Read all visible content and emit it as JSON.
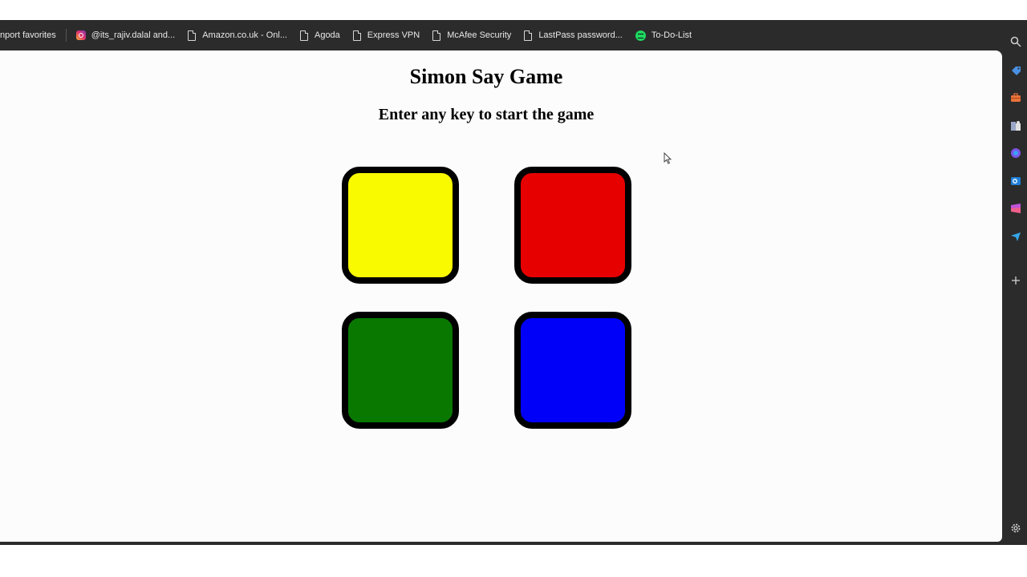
{
  "bookmarks": [
    {
      "label": "nport favorites",
      "icon": "none"
    },
    {
      "label": "@its_rajiv.dalal and...",
      "icon": "instagram-icon"
    },
    {
      "label": "Amazon.co.uk - Onl...",
      "icon": "document-icon"
    },
    {
      "label": "Agoda",
      "icon": "document-icon"
    },
    {
      "label": "Express VPN",
      "icon": "document-icon"
    },
    {
      "label": "McAfee Security",
      "icon": "document-icon"
    },
    {
      "label": "LastPass password...",
      "icon": "document-icon"
    },
    {
      "label": "To-Do-List",
      "icon": "spotify-icon"
    }
  ],
  "game": {
    "title": "Simon Say Game",
    "subtitle": "Enter any key to start the game",
    "pads": [
      {
        "name": "yellow",
        "color": "#f9f900"
      },
      {
        "name": "red",
        "color": "#e60000"
      },
      {
        "name": "green",
        "color": "#087800"
      },
      {
        "name": "blue",
        "color": "#0000f8"
      }
    ]
  },
  "sidebar_icons": [
    "search-icon",
    "shopping-tag-icon",
    "toolbox-icon",
    "chess-icon",
    "copilot-icon",
    "outlook-icon",
    "designer-icon",
    "send-icon",
    "add-icon",
    "settings-icon"
  ],
  "colors": {
    "chrome": "#2b2b2b",
    "page_background": "#fcfcfc",
    "pad_border": "#000000"
  }
}
